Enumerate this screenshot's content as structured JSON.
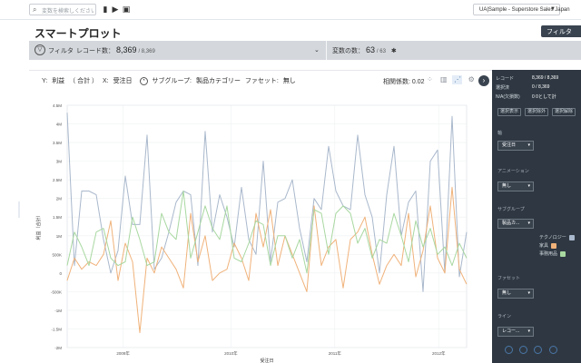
{
  "toolbar": {
    "search_placeholder": "変数を検索しください",
    "icons": [
      "search-icon",
      "bookmark-icon",
      "play-icon",
      "image-icon"
    ],
    "datasource": "UA|Sample - Superstore Sales Japan"
  },
  "page": {
    "title": "スマートプロット",
    "filter_button": "フィルタ"
  },
  "filterbar": {
    "filter_label": "フィルタ",
    "records_label": "レコード数：",
    "records_count": "8,369",
    "records_total": "/ 8,369",
    "vars_label": "変数の数：",
    "vars_count": "63",
    "vars_total": "/ 63"
  },
  "axisbar": {
    "y_label": "Y:",
    "y_value": "利益",
    "y_agg": "（ 合計 ）",
    "x_label": "X:",
    "x_value": "受注日",
    "subgroup_label": "サブグループ:",
    "subgroup_value": "製品カテゴリー",
    "facet_label": "ファセット:",
    "facet_value": "無し",
    "correlation": "相関係数: 0.02"
  },
  "colors": {
    "series_blue": "#a9b8cc",
    "series_orange": "#f0b27a",
    "series_green": "#a8d8a0",
    "panel_dark": "#2f3842",
    "filter_strip": "#d4d8dd"
  },
  "chart_data": {
    "type": "line",
    "ylabel": "利益（合計）",
    "xlabel": "受注日",
    "ylim": [
      -2000000,
      4500000
    ],
    "yticks": [
      "4.5M",
      "4M",
      "3.5M",
      "3M",
      "2.5M",
      "2M",
      "1.5M",
      "1M",
      "500K",
      "0",
      "-500K",
      "-1M",
      "-1.5M",
      "-2M"
    ],
    "xticks": [
      "2009年",
      "2010年",
      "2011年",
      "2012年"
    ],
    "series": [
      {
        "name": "テクノロジー",
        "color": "#a9b8cc",
        "values": [
          4300000,
          200000,
          2200000,
          2200000,
          2100000,
          900000,
          0,
          600000,
          2600000,
          1300000,
          1300000,
          3700000,
          100000,
          400000,
          1100000,
          1900000,
          2200000,
          2100000,
          200000,
          3800000,
          1100000,
          2100000,
          1500000,
          700000,
          2300000,
          900000,
          500000,
          3000000,
          300000,
          1900000,
          2000000,
          2500000,
          1200000,
          300000,
          2000000,
          1700000,
          3400000,
          2200000,
          1800000,
          1700000,
          3700000,
          2100000,
          1500000,
          0,
          2100000,
          3400000,
          1000000,
          1900000,
          2200000,
          -500000,
          3000000,
          3300000,
          0,
          4200000,
          -100000,
          1100000
        ]
      },
      {
        "name": "家具",
        "color": "#f0b27a",
        "values": [
          -200000,
          400000,
          100000,
          300000,
          200000,
          500000,
          1400000,
          -200000,
          800000,
          300000,
          -1600000,
          400000,
          0,
          700000,
          400000,
          100000,
          -400000,
          1600000,
          300000,
          1000000,
          -200000,
          0,
          100000,
          800000,
          400000,
          -200000,
          1600000,
          700000,
          1700000,
          200000,
          1000000,
          500000,
          0,
          -500000,
          1800000,
          200000,
          700000,
          900000,
          -400000,
          900000,
          1100000,
          1500000,
          500000,
          -300000,
          200000,
          500000,
          200000,
          1600000,
          -100000,
          600000,
          1800000,
          400000,
          0,
          2300000,
          100000,
          -300000
        ]
      },
      {
        "name": "事務用品",
        "color": "#a8d8a0",
        "values": [
          200000,
          1100000,
          700000,
          200000,
          1100000,
          1200000,
          400000,
          200000,
          300000,
          1500000,
          900000,
          200000,
          300000,
          1600000,
          1100000,
          900000,
          2200000,
          400000,
          1100000,
          1800000,
          1200000,
          900000,
          1800000,
          400000,
          300000,
          800000,
          1400000,
          1300000,
          200000,
          1000000,
          1000000,
          400000,
          900000,
          0,
          1700000,
          1600000,
          500000,
          1600000,
          1800000,
          1600000,
          800000,
          1200000,
          400000,
          900000,
          800000,
          1600000,
          1000000,
          300000,
          1400000,
          700000,
          1200000,
          500000,
          700000,
          200000,
          800000,
          400000
        ]
      }
    ]
  },
  "sidepanel": {
    "rows": [
      {
        "label": "レコード",
        "value": "8,369 / 8,369"
      },
      {
        "label": "選択済",
        "value": "0 / 8,369"
      },
      {
        "label": "N/A(欠損数)",
        "value": "0  0として計"
      }
    ],
    "buttons": [
      "選択表示",
      "選択除外",
      "選択解除"
    ],
    "sections": [
      {
        "title": "軸",
        "select": "受注日"
      },
      {
        "title": "アニメーション",
        "select": "無し"
      },
      {
        "title": "サブグループ",
        "select": "製品カ..."
      },
      {
        "title": "ファセット",
        "select": "無し"
      },
      {
        "title": "ライン",
        "select": "レコー..."
      }
    ],
    "legend": [
      {
        "name": "テクノロジー",
        "color": "#a9b8cc"
      },
      {
        "name": "家具",
        "color": "#f0b27a"
      },
      {
        "name": "事務用品",
        "color": "#a8d8a0"
      }
    ]
  }
}
